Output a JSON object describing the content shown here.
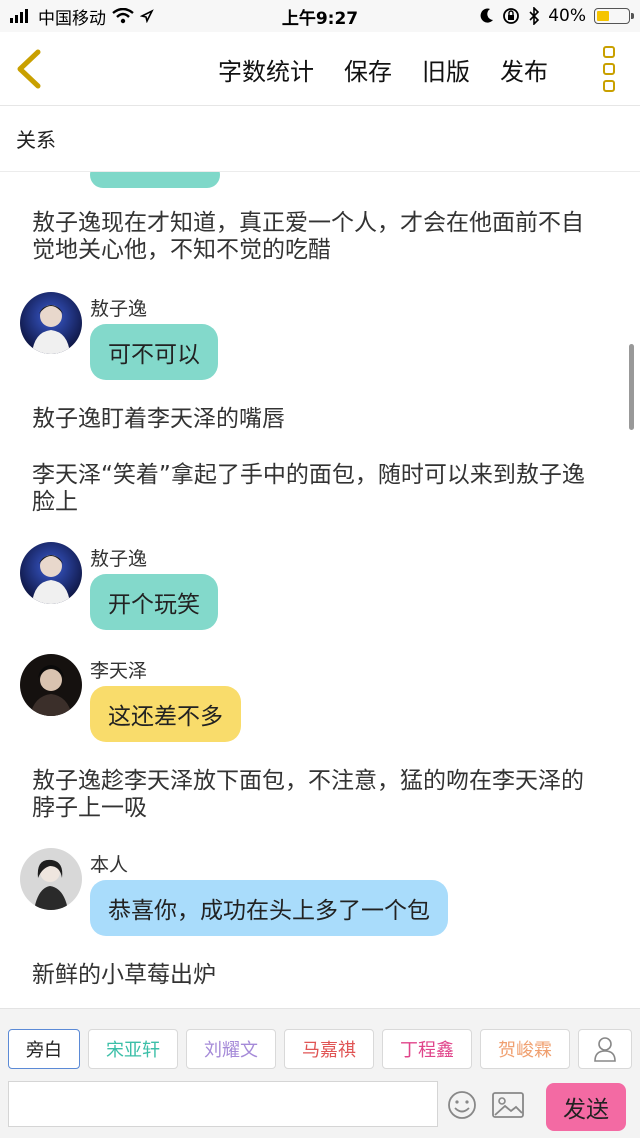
{
  "status_bar": {
    "carrier": "中国移动",
    "time": "上午9:27",
    "battery_text": "40%",
    "battery_level": 0.4
  },
  "nav": {
    "word_count": "字数统计",
    "save": "保存",
    "old_version": "旧版",
    "publish": "发布"
  },
  "title": "关系",
  "messages": [
    {
      "type": "narration",
      "text": "敖子逸现在才知道，真正爱一个人，才会在他面前不自觉地关心他，不知不觉的吃醋"
    },
    {
      "type": "dialog",
      "speaker": "敖子逸",
      "text": "可不可以",
      "color": "#83d9cb"
    },
    {
      "type": "narration",
      "text": "敖子逸盯着李天泽的嘴唇"
    },
    {
      "type": "narration",
      "text": "李天泽“笑着”拿起了手中的面包，随时可以来到敖子逸脸上"
    },
    {
      "type": "dialog",
      "speaker": "敖子逸",
      "text": "开个玩笑",
      "color": "#83d9cb"
    },
    {
      "type": "dialog",
      "speaker": "李天泽",
      "text": "这还差不多",
      "color": "#f9dc6b"
    },
    {
      "type": "narration",
      "text": "敖子逸趁李天泽放下面包，不注意，猛的吻在李天泽的脖子上一吸"
    },
    {
      "type": "dialog",
      "speaker": "本人",
      "text": "恭喜你，成功在头上多了一个包",
      "color": "#a9dcfb"
    },
    {
      "type": "narration",
      "text": "新鲜的小草莓出炉"
    }
  ],
  "characters": [
    {
      "name": "旁白",
      "color": "#222222"
    },
    {
      "name": "宋亚轩",
      "color": "#3cbfa8"
    },
    {
      "name": "刘耀文",
      "color": "#a58ad8"
    },
    {
      "name": "马嘉祺",
      "color": "#e05555"
    },
    {
      "name": "丁程鑫",
      "color": "#e0448a"
    },
    {
      "name": "贺峻霖",
      "color": "#f0a070"
    }
  ],
  "input": {
    "value": "",
    "placeholder": ""
  },
  "send_label": "发送",
  "icons": {
    "back": "chevron-left-icon",
    "more": "more-vertical-icon",
    "person": "person-icon",
    "emoji": "emoji-icon",
    "image": "image-icon"
  },
  "colors": {
    "accent": "#c9a000",
    "send": "#f36aa3"
  }
}
